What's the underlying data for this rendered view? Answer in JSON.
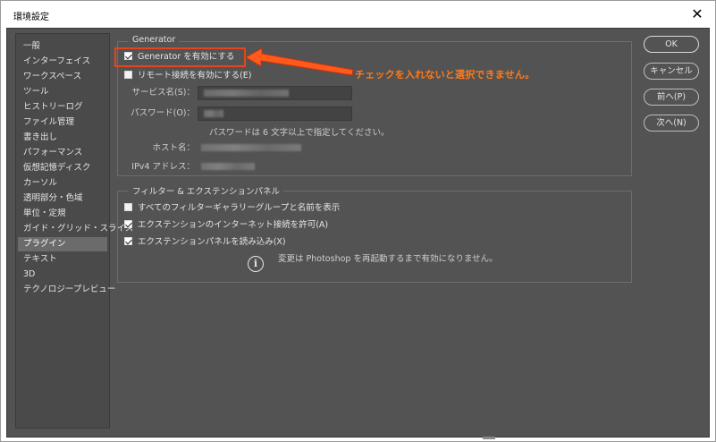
{
  "window": {
    "title": "環境設定",
    "close_glyph": "✕"
  },
  "sidebar": {
    "items": [
      {
        "label": "一般"
      },
      {
        "label": "インターフェイス"
      },
      {
        "label": "ワークスペース"
      },
      {
        "label": "ツール"
      },
      {
        "label": "ヒストリーログ"
      },
      {
        "label": "ファイル管理"
      },
      {
        "label": "書き出し"
      },
      {
        "label": "パフォーマンス"
      },
      {
        "label": "仮想記憶ディスク"
      },
      {
        "label": "カーソル"
      },
      {
        "label": "透明部分・色域"
      },
      {
        "label": "単位・定規"
      },
      {
        "label": "ガイド・グリッド・スライス"
      },
      {
        "label": "プラグイン",
        "selected": true
      },
      {
        "label": "テキスト"
      },
      {
        "label": "3D"
      },
      {
        "label": "テクノロジープレビュー"
      }
    ]
  },
  "generator": {
    "group_label": "Generator",
    "enable_label": "Generator を有効にする",
    "enable_checked": true,
    "remote_label": "リモート接続を有効にする(E)",
    "remote_checked": false,
    "service_name_label": "サービス名(S)：",
    "password_label": "パスワード(O)：",
    "password_hint": "パスワードは 6 文字以上で指定してください。",
    "host_label": "ホスト名：",
    "ipv4_label": "IPv4 アドレス："
  },
  "filters": {
    "group_label": "フィルター & エクステンションパネル",
    "options": [
      {
        "label": "すべてのフィルターギャラリーグループと名前を表示",
        "checked": false
      },
      {
        "label": "エクステンションのインターネット接続を許可(A)",
        "checked": true
      },
      {
        "label": "エクステンションパネルを読み込み(X)",
        "checked": true
      }
    ],
    "restart_note": "変更は Photoshop を再起動するまで有効になりません。",
    "info_glyph": "i"
  },
  "buttons": {
    "ok": "OK",
    "cancel": "キャンセル",
    "prev": "前へ(P)",
    "next": "次へ(N)"
  },
  "annotation": {
    "text": "チェックを入れないと選択できません。",
    "color": "#ff7a1a",
    "highlight_color": "#e5451c"
  }
}
